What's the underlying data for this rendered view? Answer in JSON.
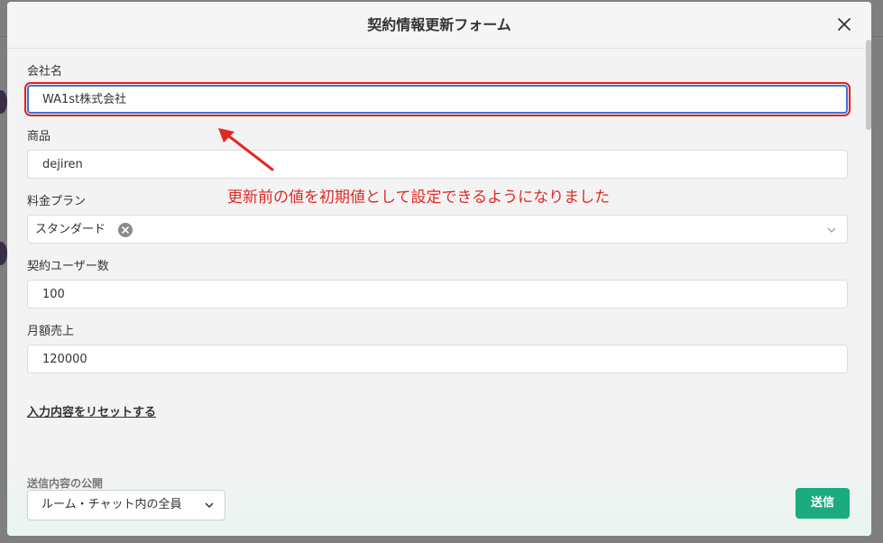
{
  "modal": {
    "title": "契約情報更新フォーム",
    "close_icon": "close-icon"
  },
  "fields": {
    "company": {
      "label": "会社名",
      "value": "WA1st株式会社"
    },
    "product": {
      "label": "商品",
      "value": "dejiren"
    },
    "plan": {
      "label": "料金プラン",
      "value": "スタンダード"
    },
    "users": {
      "label": "契約ユーザー数",
      "value": "100"
    },
    "monthly_sales": {
      "label": "月額売上",
      "value": "120000"
    }
  },
  "reset_link": "入力内容をリセットする",
  "footer": {
    "publish_label": "送信内容の公開",
    "publish_value": "ルーム・チャット内の全員",
    "submit_label": "送信"
  },
  "annotation": {
    "text": "更新前の値を初期値として設定できるようになりました",
    "color": "#e02a24"
  },
  "colors": {
    "accent": "#1aab7f",
    "focus_border": "#3a73d6"
  }
}
